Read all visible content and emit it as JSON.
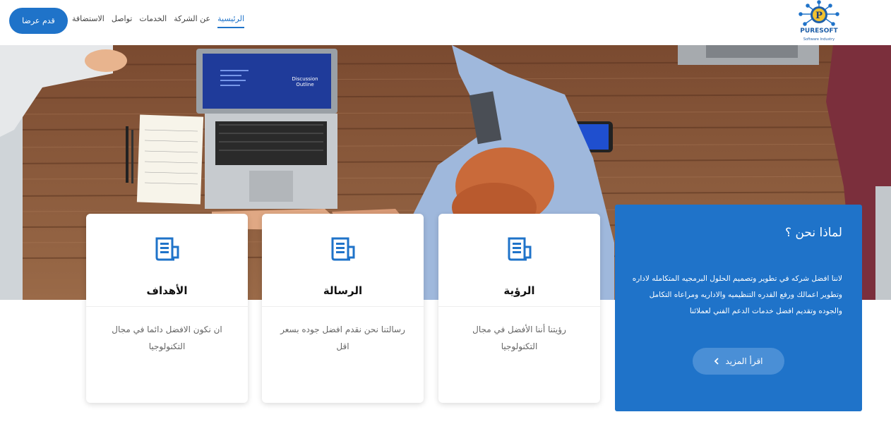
{
  "header": {
    "cta_label": "قدم عرضا",
    "nav": [
      {
        "label": "الرئيسية",
        "active": true
      },
      {
        "label": "عن الشركة"
      },
      {
        "label": "الخدمات"
      },
      {
        "label": "تواصل"
      },
      {
        "label": "الاستضافة"
      }
    ],
    "logo": {
      "text": "PURESOFT",
      "tagline": "Software Industry",
      "letter": "P"
    }
  },
  "hero": {
    "laptop_screen_line1": "Discussion",
    "laptop_screen_line2": "Outline"
  },
  "cards": [
    {
      "title": "الرؤية",
      "text": "رؤيتنا أننا الأفضل في مجال التكنولوجيا",
      "icon": "document-icon"
    },
    {
      "title": "الرسالة",
      "text": "رسالتنا نحن نقدم افضل جوده بسعر اقل",
      "icon": "document-icon"
    },
    {
      "title": "الأهداف",
      "text": "ان نكون الافضل دائما في مجال التكنولوجيا",
      "icon": "document-icon"
    }
  ],
  "why": {
    "title": "لماذا نحن ؟",
    "text": "لاننا افضل شركه في تطوير وتصميم الحلول البرمجيه المتكامله لاداره وتطوير اعمالك ورفع القدره التنظيميه والاداريه ومراعاه التكامل والجوده وتقديم افضل خدمات الدعم الفني لعملائنا",
    "button_label": "اقرأ المزيد",
    "button_icon": "chevron-left-icon"
  },
  "colors": {
    "accent": "#1f73c9",
    "wood": "#8a5a3c"
  }
}
